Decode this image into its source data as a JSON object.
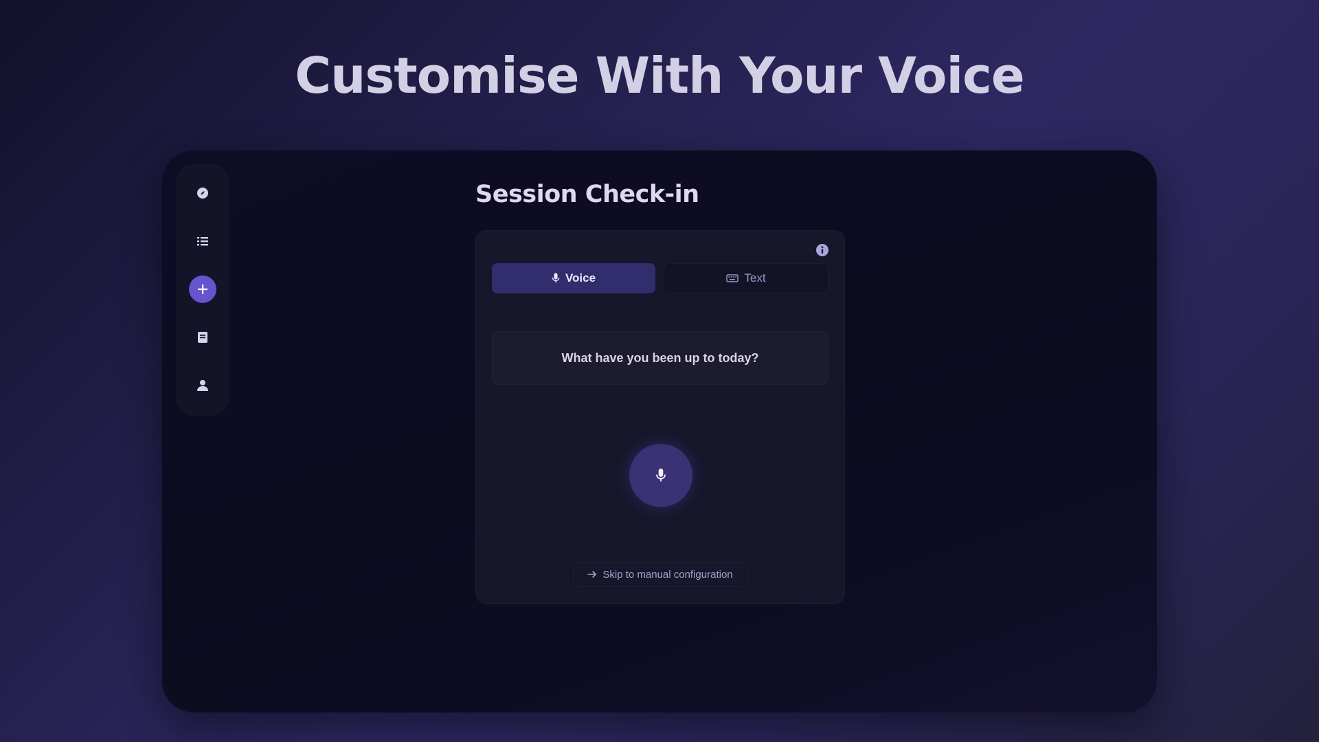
{
  "headline": "Customise With Your Voice",
  "sidebar": {
    "items": [
      {
        "icon": "compass-icon",
        "label": "Explore"
      },
      {
        "icon": "list-icon",
        "label": "List"
      },
      {
        "icon": "plus-icon",
        "label": "Add",
        "active": true
      },
      {
        "icon": "book-icon",
        "label": "Journal"
      },
      {
        "icon": "user-icon",
        "label": "Profile"
      }
    ]
  },
  "page": {
    "title": "Session Check-in"
  },
  "card": {
    "info_icon": "info-icon",
    "tabs": [
      {
        "label": "Voice",
        "icon": "microphone-icon",
        "selected": true
      },
      {
        "label": "Text",
        "icon": "keyboard-icon",
        "selected": false
      }
    ],
    "prompt": "What have you been up to today?",
    "record_button_icon": "microphone-icon",
    "skip_label": "Skip to manual configuration",
    "skip_icon": "arrow-right-icon"
  },
  "colors": {
    "accent": "#6654cc",
    "active_tab": "#322d6c",
    "mic_button": "#3a3275",
    "card_bg": "#17162a"
  }
}
